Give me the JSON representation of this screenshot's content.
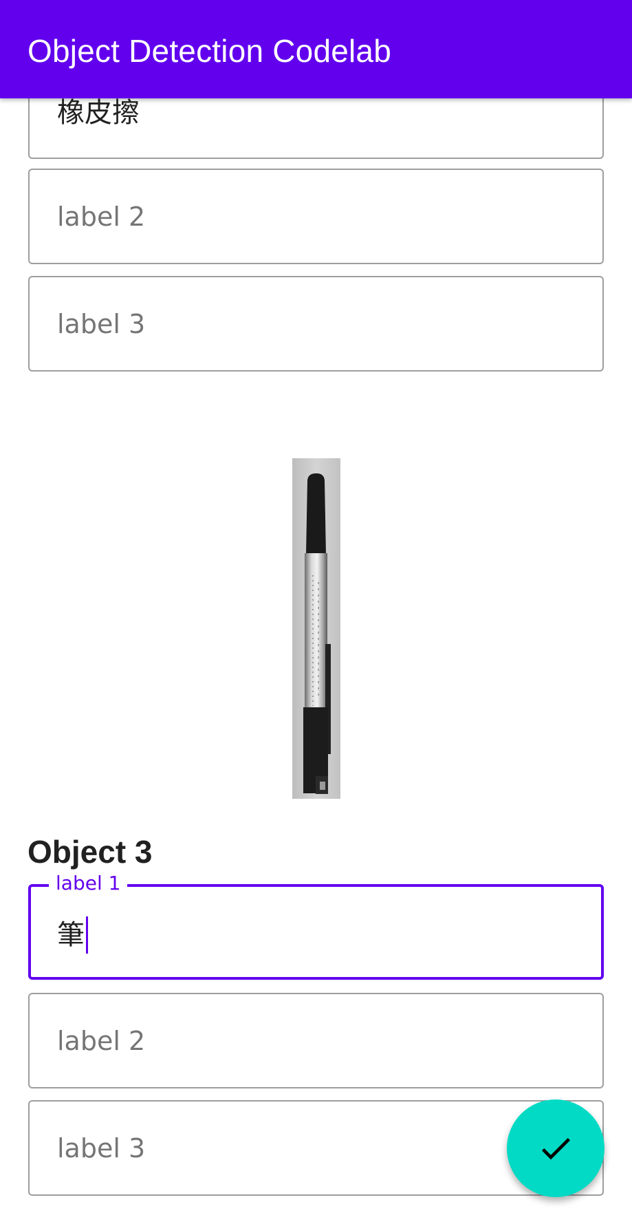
{
  "app_bar": {
    "title": "Object Detection Codelab"
  },
  "object_2": {
    "label_1_value": "橡皮擦",
    "label_2_placeholder": "label 2",
    "label_3_placeholder": "label 3"
  },
  "object_3": {
    "heading": "Object 3",
    "label_1_floating": "label 1",
    "label_1_value": "筆",
    "label_2_placeholder": "label 2",
    "label_3_placeholder": "label 3"
  },
  "fab": {
    "icon": "check-icon"
  },
  "colors": {
    "primary": "#6200ee",
    "secondary": "#03dac5",
    "outline": "#9e9e9e",
    "placeholder": "#757575"
  }
}
